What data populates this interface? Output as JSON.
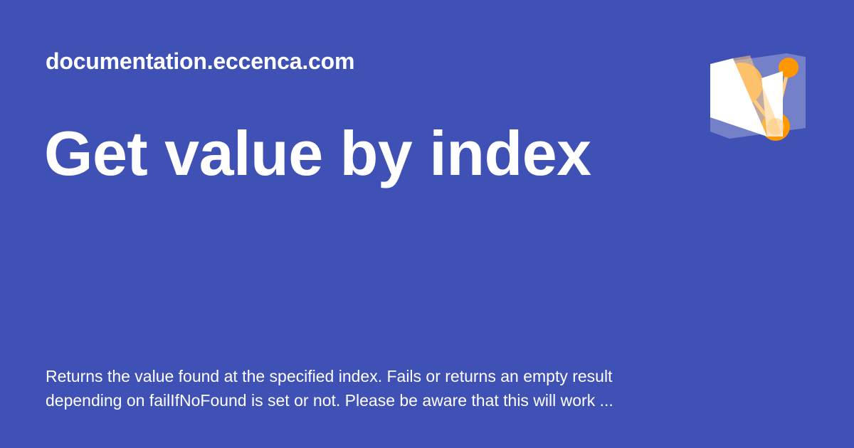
{
  "header": {
    "site_name": "documentation.eccenca.com"
  },
  "main": {
    "title": "Get value by index",
    "description": "Returns the value found at the specified index. Fails or returns an empty result depending on failIfNoFound is set or not. Please be aware that this will work ..."
  },
  "logo": {
    "icon": "eccenca-logo-icon"
  },
  "colors": {
    "background": "#3f51b5",
    "text": "#ffffff",
    "accent": "#ff9800",
    "accent_light": "#ffcc80"
  }
}
